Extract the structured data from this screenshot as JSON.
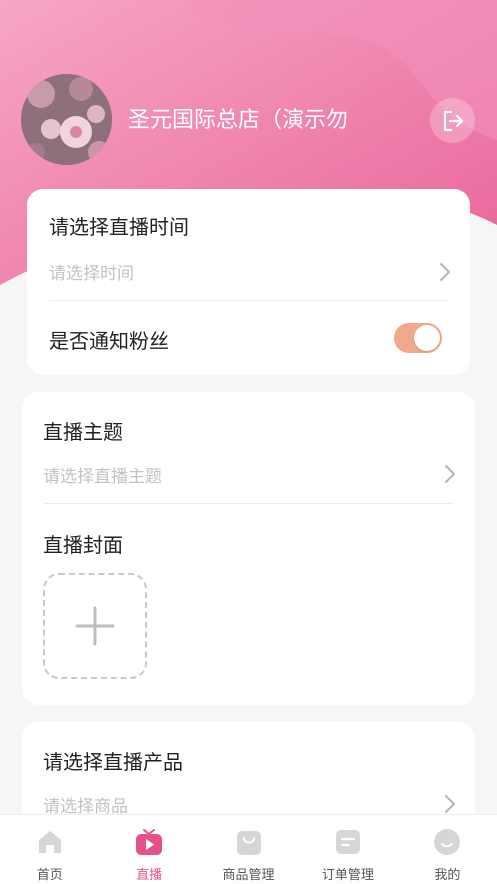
{
  "header": {
    "store_name": "圣元国际总店（演示勿",
    "gradient_start": "#f59ebf",
    "gradient_end": "#e7689a"
  },
  "card_schedule": {
    "time_label": "请选择直播时间",
    "time_placeholder": "请选择时间",
    "notify_label": "是否通知粉丝",
    "notify_on": true
  },
  "card_details": {
    "topic_label": "直播主题",
    "topic_placeholder": "请选择直播主题",
    "cover_label": "直播封面"
  },
  "card_products": {
    "product_label": "请选择直播产品",
    "product_placeholder": "请选择商品"
  },
  "tabbar": {
    "tabs": [
      {
        "label": "首页",
        "icon": "home-icon",
        "active": false
      },
      {
        "label": "直播",
        "icon": "live-play-icon",
        "active": true
      },
      {
        "label": "商品管理",
        "icon": "shopping-bag-icon",
        "active": false
      },
      {
        "label": "订单管理",
        "icon": "order-document-icon",
        "active": false
      },
      {
        "label": "我的",
        "icon": "profile-smile-icon",
        "active": false
      }
    ],
    "active_color": "#e7518b",
    "inactive_color": "#d6d6d6"
  }
}
